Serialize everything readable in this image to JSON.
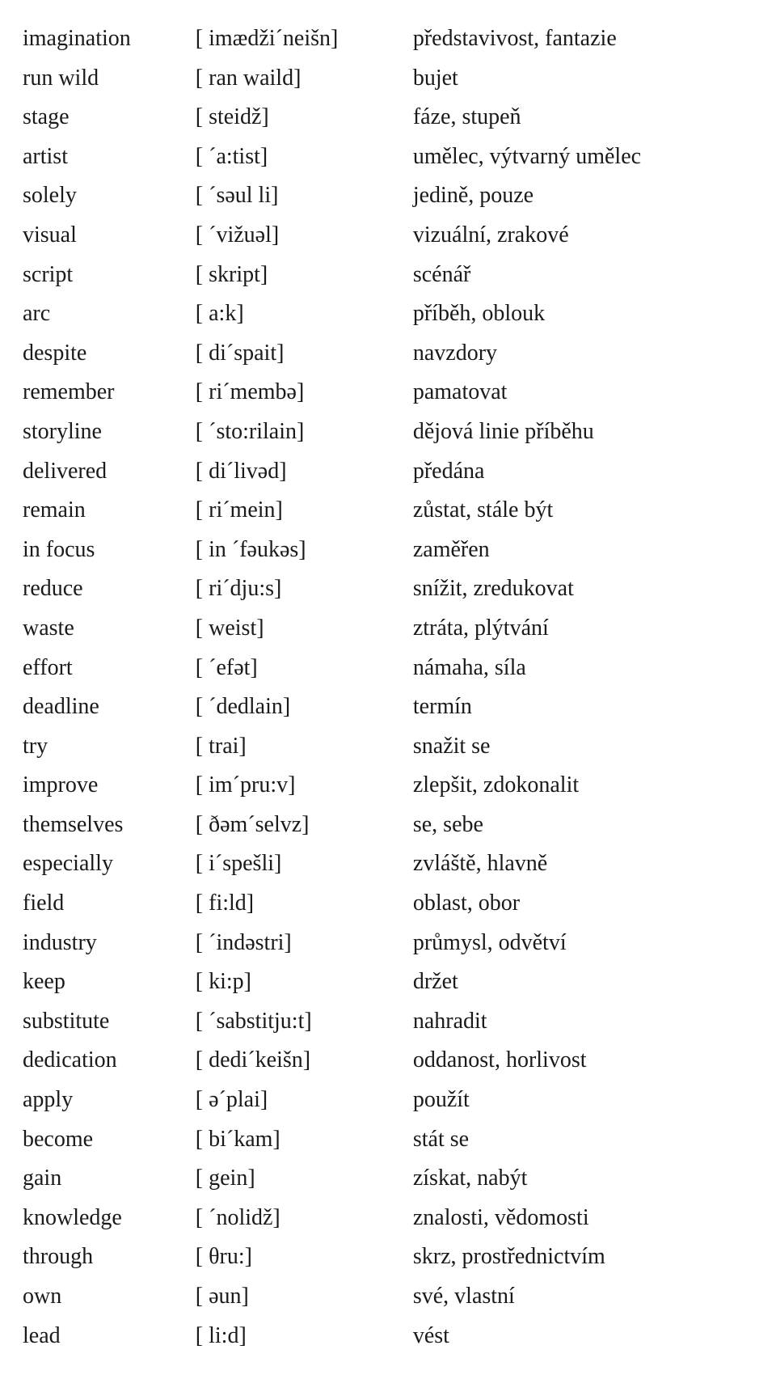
{
  "vocab": [
    {
      "word": "imagination",
      "phonetic": "[ imædži´neišn]",
      "translation": "představivost, fantazie"
    },
    {
      "word": "run wild",
      "phonetic": "[ ran waild]",
      "translation": "bujet"
    },
    {
      "word": "stage",
      "phonetic": "[ steidž]",
      "translation": "fáze, stupeň"
    },
    {
      "word": "artist",
      "phonetic": "[ ´a:tist]",
      "translation": "umělec, výtvarný umělec"
    },
    {
      "word": "solely",
      "phonetic": "[ ´səul li]",
      "translation": "jedině, pouze"
    },
    {
      "word": "visual",
      "phonetic": "[ ´vižuəl]",
      "translation": "vizuální, zrakové"
    },
    {
      "word": "script",
      "phonetic": "[ skript]",
      "translation": "scénář"
    },
    {
      "word": "arc",
      "phonetic": "[ a:k]",
      "translation": "příběh, oblouk"
    },
    {
      "word": "despite",
      "phonetic": "[ di´spait]",
      "translation": "navzdory"
    },
    {
      "word": "remember",
      "phonetic": "[ ri´membə]",
      "translation": "pamatovat"
    },
    {
      "word": "storyline",
      "phonetic": "[ ´sto:rilain]",
      "translation": "dějová linie příběhu"
    },
    {
      "word": "delivered",
      "phonetic": "[ di´livəd]",
      "translation": "předána"
    },
    {
      "word": "remain",
      "phonetic": "[ ri´mein]",
      "translation": "zůstat, stále být"
    },
    {
      "word": "in focus",
      "phonetic": "[ in ´fəukəs]",
      "translation": "zaměřen"
    },
    {
      "word": "reduce",
      "phonetic": "[ ri´dju:s]",
      "translation": "snížit, zredukovat"
    },
    {
      "word": "waste",
      "phonetic": "[ weist]",
      "translation": "ztráta, plýtvání"
    },
    {
      "word": "effort",
      "phonetic": "[ ´efət]",
      "translation": "námaha, síla"
    },
    {
      "word": "deadline",
      "phonetic": "[ ´dedlain]",
      "translation": "termín"
    },
    {
      "word": "try",
      "phonetic": "[ trai]",
      "translation": "snažit se"
    },
    {
      "word": "improve",
      "phonetic": "[ im´pru:v]",
      "translation": "zlepšit, zdokonalit"
    },
    {
      "word": "themselves",
      "phonetic": "[ ðəm´selvz]",
      "translation": "se, sebe"
    },
    {
      "word": "especially",
      "phonetic": "[ i´spešli]",
      "translation": "zvláště, hlavně"
    },
    {
      "word": "field",
      "phonetic": "[ fi:ld]",
      "translation": "oblast, obor"
    },
    {
      "word": "industry",
      "phonetic": "[ ´indəstri]",
      "translation": "průmysl, odvětví"
    },
    {
      "word": "keep",
      "phonetic": "[ ki:p]",
      "translation": "držet"
    },
    {
      "word": "substitute",
      "phonetic": "[ ´sabstitju:t]",
      "translation": "nahradit"
    },
    {
      "word": "dedication",
      "phonetic": "[ dedi´keišn]",
      "translation": "oddanost, horlivost"
    },
    {
      "word": "apply",
      "phonetic": "[ ə´plai]",
      "translation": "použít"
    },
    {
      "word": "become",
      "phonetic": "[ bi´kam]",
      "translation": "stát se"
    },
    {
      "word": "gain",
      "phonetic": "[ gein]",
      "translation": "získat, nabýt"
    },
    {
      "word": "knowledge",
      "phonetic": "[ ´nolidž]",
      "translation": "znalosti, vědomosti"
    },
    {
      "word": "through",
      "phonetic": "[ θru:]",
      "translation": "skrz, prostřednictvím"
    },
    {
      "word": "own",
      "phonetic": "[ əun]",
      "translation": "své, vlastní"
    },
    {
      "word": "lead",
      "phonetic": "[ li:d]",
      "translation": "vést"
    }
  ]
}
